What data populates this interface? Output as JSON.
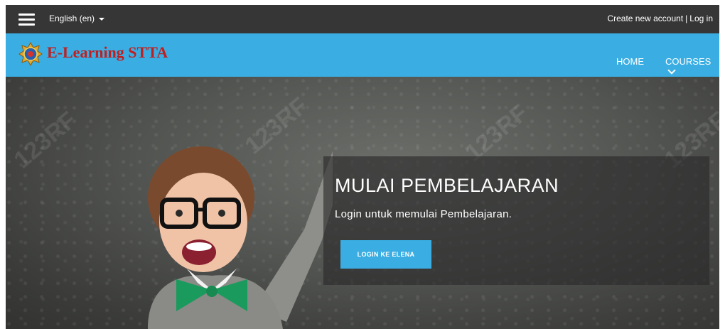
{
  "topbar": {
    "language": "English (en)",
    "create_account": "Create new account",
    "separator": "|",
    "login": "Log in"
  },
  "navbar": {
    "brand": "E-Learning STTA",
    "items": [
      {
        "label": "HOME"
      },
      {
        "label": "COURSES"
      }
    ]
  },
  "hero": {
    "title": "MULAI PEMBELAJARAN",
    "subtitle": "Login untuk memulai Pembelajaran.",
    "button": "LOGIN KE ELENA",
    "watermark": "123RF"
  },
  "colors": {
    "topbar": "#363636",
    "accent": "#3aaee3",
    "brand_text": "#c01f1f"
  },
  "icons": [
    "hamburger-menu-icon",
    "caret-down-icon",
    "chevron-down-icon",
    "logo-emblem-icon"
  ]
}
